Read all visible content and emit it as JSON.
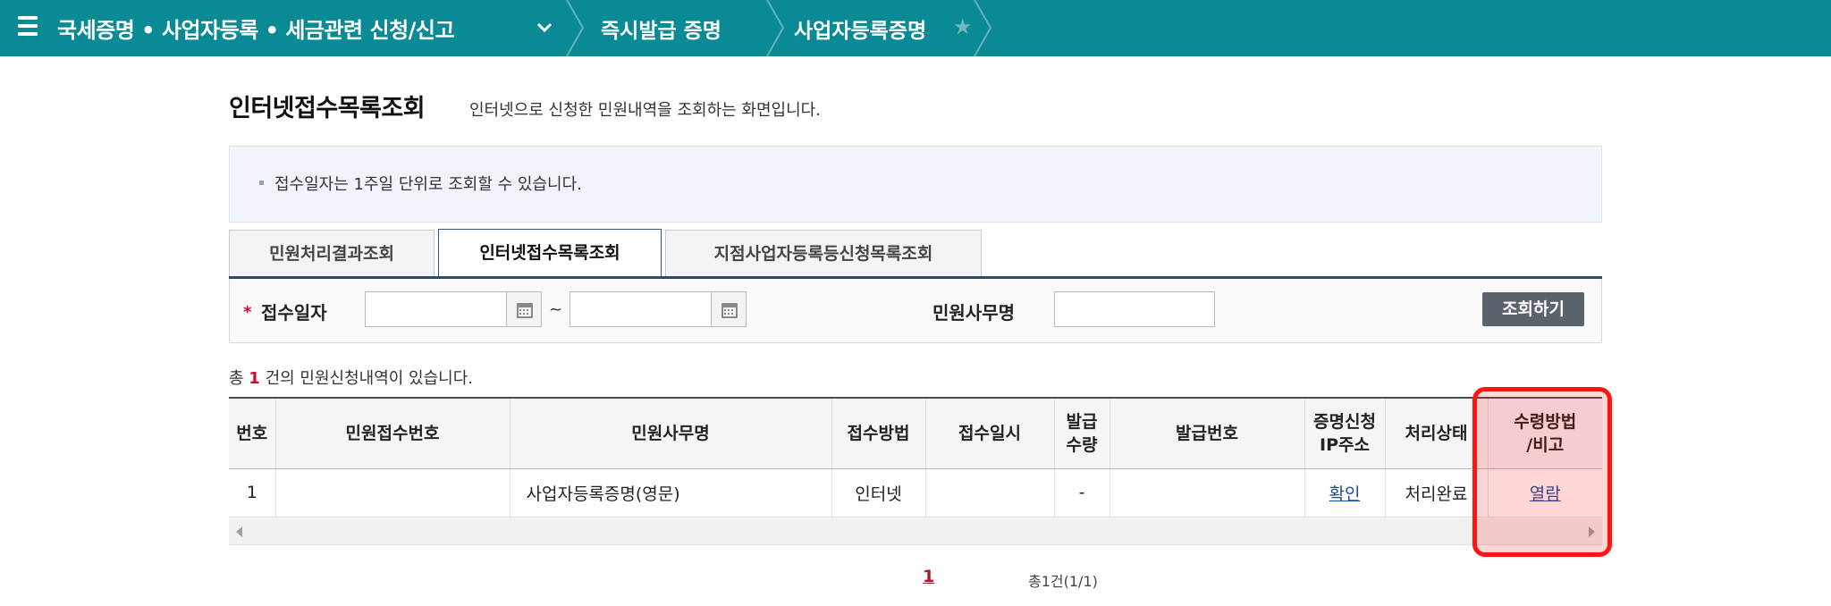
{
  "nav": {
    "menu_title": "국세증명 • 사업자등록 • 세금관련 신청/신고",
    "crumbs": [
      "즉시발급 증명",
      "사업자등록증명"
    ]
  },
  "page": {
    "title": "인터넷접수목록조회",
    "description": "인터넷으로 신청한 민원내역을 조회하는 화면입니다."
  },
  "notice": {
    "text": "접수일자는 1주일 단위로 조회할 수 있습니다."
  },
  "tabs": [
    {
      "label": "민원처리결과조회"
    },
    {
      "label": "인터넷접수목록조회"
    },
    {
      "label": "지점사업자등록등신청목록조회"
    }
  ],
  "search": {
    "required_mark": "*",
    "date_label": "접수일자",
    "date_from": "",
    "date_to": "",
    "tilde": "~",
    "service_label": "민원사무명",
    "service_value": "",
    "search_button": "조회하기"
  },
  "summary": {
    "prefix": "총",
    "count": "1",
    "suffix": "건의 민원신청내역이 있습니다."
  },
  "table": {
    "headers": {
      "no": "번호",
      "receipt_no": "민원접수번호",
      "service": "민원사무명",
      "method": "접수방법",
      "datetime": "접수일시",
      "qty_1": "발급",
      "qty_2": "수량",
      "issue_no": "발급번호",
      "ip_1": "증명신청",
      "ip_2": "IP주소",
      "status": "처리상태",
      "receive_1": "수령방법",
      "receive_2": "/비고"
    },
    "rows": [
      {
        "no": "1",
        "receipt_no": "",
        "service": "사업자등록증명(영문)",
        "method": "인터넷",
        "datetime": "",
        "qty": "-",
        "issue_no": "",
        "ip": "확인",
        "status": "처리완료",
        "receive": "열람"
      }
    ]
  },
  "pagination": {
    "current": "1",
    "info": "총1건(1/1)"
  },
  "colors": {
    "nav_bg": "#0a8a94",
    "highlight": "#ff1414",
    "accent_red": "#c8102e"
  }
}
